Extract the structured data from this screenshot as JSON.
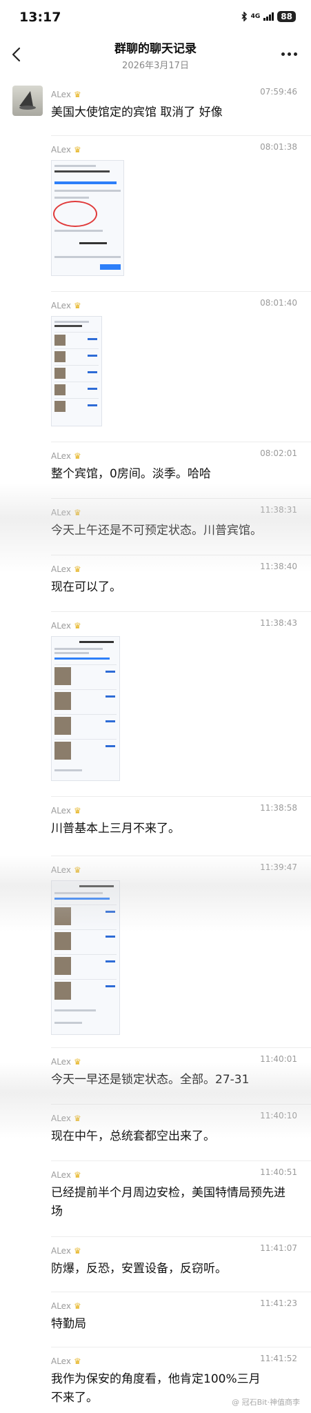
{
  "status_bar": {
    "time": "13:17",
    "network": "4G",
    "battery": "88"
  },
  "nav": {
    "title": "群聊的聊天记录",
    "subtitle": "2026年3月17日"
  },
  "messages": [
    {
      "sender": "ALex",
      "time": "07:59:46",
      "text": "美国大使馆定的宾馆 取消了 好像"
    },
    {
      "sender": "ALex",
      "time": "08:01:38",
      "text": ""
    },
    {
      "sender": "ALex",
      "time": "08:01:40",
      "text": ""
    },
    {
      "sender": "ALex",
      "time": "08:02:01",
      "text": "整个宾馆，0房间。淡季。哈哈"
    },
    {
      "sender": "ALex",
      "time": "11:38:31",
      "text": "今天上午还是不可预定状态。川普宾馆。"
    },
    {
      "sender": "ALex",
      "time": "11:38:40",
      "text": "现在可以了。"
    },
    {
      "sender": "ALex",
      "time": "11:38:43",
      "text": ""
    },
    {
      "sender": "ALex",
      "time": "11:38:58",
      "text": "川普基本上三月不来了。"
    },
    {
      "sender": "ALex",
      "time": "11:39:47",
      "text": ""
    },
    {
      "sender": "ALex",
      "time": "11:40:01",
      "text": "今天一早还是锁定状态。全部。27-31"
    },
    {
      "sender": "ALex",
      "time": "11:40:10",
      "text": "现在中午，总统套都空出来了。"
    },
    {
      "sender": "ALex",
      "time": "11:40:51",
      "text": "已经提前半个月周边安检，美国特情局预先进场"
    },
    {
      "sender": "ALex",
      "time": "11:41:07",
      "text": "防爆，反恐，安置设备，反窃听。"
    },
    {
      "sender": "ALex",
      "time": "11:41:23",
      "text": "特勤局"
    },
    {
      "sender": "ALex",
      "time": "11:41:52",
      "text": "我作为保安的角度看，他肯定100%三月不来了。"
    }
  ],
  "watermark": "@ 冠石Bit·神值商李",
  "icons": {
    "back": "chevron-left-icon",
    "more": "more-dots-icon",
    "crown": "crown-icon"
  },
  "colors": {
    "meta_text": "#9a9a9a",
    "crown": "#e6b422",
    "link_blue": "#2d6bd6",
    "circle_red": "#e03a3a"
  }
}
